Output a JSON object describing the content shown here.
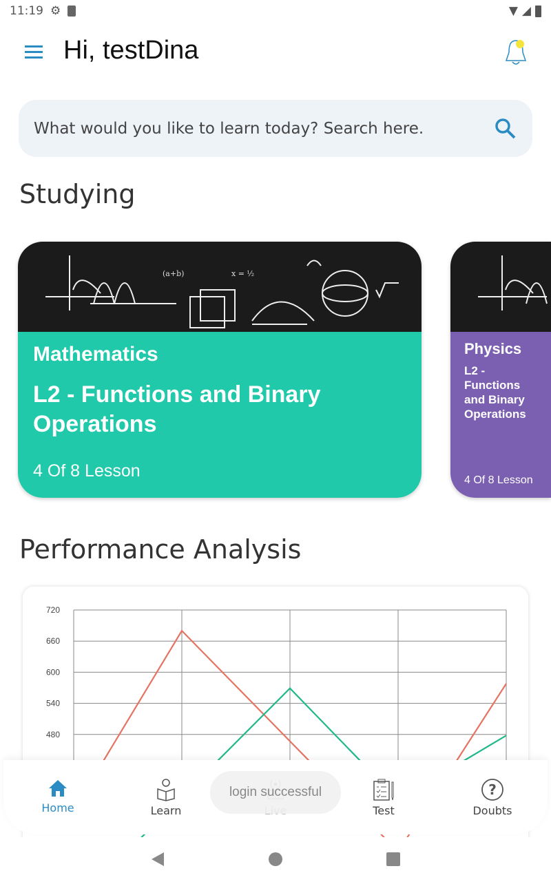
{
  "status_bar": {
    "time": "11:19"
  },
  "header": {
    "greeting": "Hi, testDina"
  },
  "search": {
    "placeholder": "What would you like to learn today? Search here."
  },
  "studying": {
    "heading": "Studying",
    "cards": [
      {
        "subject": "Mathematics",
        "title": "L2 - Functions and Binary Operations",
        "progress": "4 Of 8 Lesson",
        "color": "#20c9a9"
      },
      {
        "subject": "Physics",
        "title": "L2 - Functions and Binary Operations",
        "progress": "4 Of 8 Lesson",
        "color": "#7b5fb0"
      }
    ]
  },
  "performance": {
    "heading": "Performance Analysis"
  },
  "chart_data": {
    "type": "line",
    "yticks": [
      480,
      540,
      600,
      660,
      720
    ],
    "ylim": [
      300,
      720
    ],
    "x": [
      1,
      2,
      3,
      4,
      5
    ],
    "grid": true,
    "series": [
      {
        "color": "#e57361",
        "values": [
          334,
          680,
          467,
          254,
          578
        ]
      },
      {
        "color": "#1fb88a",
        "values": [
          150,
          360,
          569,
          354,
          478
        ]
      }
    ]
  },
  "bottom_nav": {
    "items": [
      {
        "label": "Home",
        "active": true
      },
      {
        "label": "Learn"
      },
      {
        "label": "Live"
      },
      {
        "label": "Test"
      },
      {
        "label": "Doubts"
      }
    ]
  },
  "toast": {
    "text": "login successful"
  },
  "colors": {
    "accent": "#2b8cc4"
  }
}
